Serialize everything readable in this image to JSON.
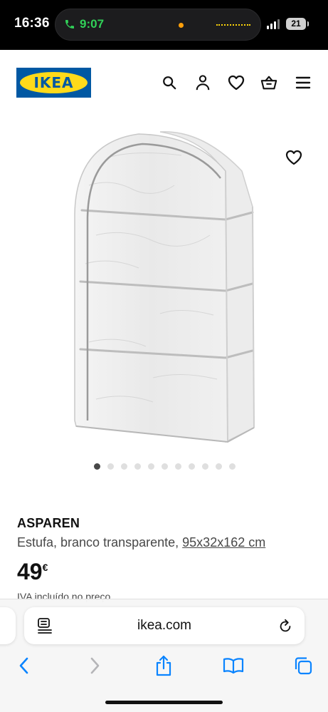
{
  "status_bar": {
    "time": "16:36",
    "call_timer": "9:07",
    "battery": "21"
  },
  "header": {
    "logo_text": "IKEA",
    "icons": [
      "search-icon",
      "account-icon",
      "favourites-icon",
      "basket-icon",
      "menu-icon"
    ]
  },
  "gallery": {
    "image_count": 11,
    "active_index": 0
  },
  "product": {
    "name": "ASPAREN",
    "description": "Estufa, branco transparente,",
    "dimensions": "95x32x162 cm",
    "price": "49",
    "currency": "€",
    "vat_note": "IVA incluído no preço"
  },
  "browser": {
    "url": "ikea.com",
    "toolbar": [
      "back-icon",
      "forward-icon",
      "share-icon",
      "bookmarks-icon",
      "tabs-icon"
    ]
  },
  "colors": {
    "ikea_blue": "#0058a3",
    "ikea_yellow": "#ffda1a",
    "safari_blue": "#0a84ff",
    "call_green": "#31d158"
  }
}
